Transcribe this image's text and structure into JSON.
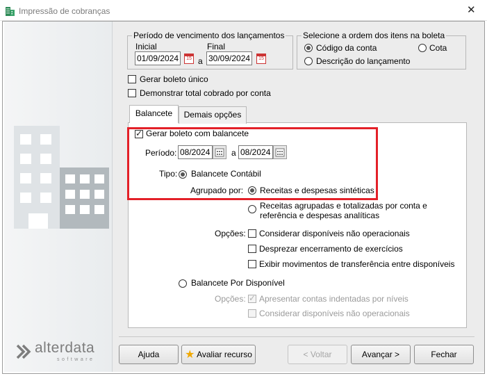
{
  "window": {
    "title": "Impressão de cobranças"
  },
  "period": {
    "legend": "Período de vencimento dos lançamentos",
    "start_label": "Inicial",
    "start_value": "01/09/2024",
    "end_label": "Final",
    "end_value": "30/09/2024",
    "separator": "a"
  },
  "order": {
    "legend": "Selecione a ordem dos itens na boleta",
    "options": [
      {
        "label": "Código da conta",
        "selected": true
      },
      {
        "label": "Cota",
        "selected": false
      },
      {
        "label": "Descrição do lançamento",
        "selected": false
      }
    ]
  },
  "checks": {
    "single_boleto": "Gerar boleto único",
    "show_total": "Demonstrar total cobrado por conta"
  },
  "tabs": [
    {
      "label": "Balancete",
      "active": true
    },
    {
      "label": "Demais opções",
      "active": false
    }
  ],
  "balancete": {
    "generate_label": "Gerar boleto com balancete",
    "period_label": "Período:",
    "period_from": "08/2024",
    "period_sep": "a",
    "period_to": "08/2024",
    "type_label": "Tipo:",
    "type_contabil": "Balancete Contábil",
    "grouped_label": "Agrupado por:",
    "group_option_1": "Receitas e despesas sintéticas",
    "group_option_2_line1": "Receitas agrupadas e totalizadas por conta e",
    "group_option_2_line2": "referência e despesas analíticas",
    "options_label": "Opções:",
    "option_1": "Considerar disponíveis não operacionais",
    "option_2": "Desprezar encerramento de exercícios",
    "option_3": "Exibir movimentos de transferência entre disponíveis",
    "type_disponivel": "Balancete Por Disponível",
    "options_label_2": "Opções:",
    "disp_option_1": "Apresentar contas indentadas por níveis",
    "disp_option_2": "Considerar disponíveis não operacionais"
  },
  "brand": {
    "name": "alterdata",
    "tagline": "software"
  },
  "buttons": {
    "help": "Ajuda",
    "evaluate": "Avaliar recurso",
    "back": "< Voltar",
    "next": "Avançar >",
    "close": "Fechar"
  },
  "colors": {
    "highlight": "#e32028",
    "building_light": "#dfe3e6",
    "building_dark": "#b2b9bd"
  }
}
